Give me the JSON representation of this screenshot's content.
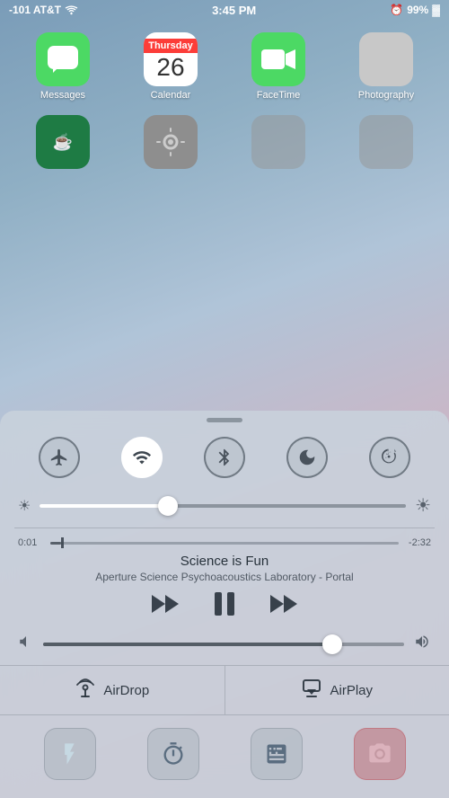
{
  "statusBar": {
    "carrier": "-101 AT&T",
    "time": "3:45 PM",
    "battery": "99%",
    "batteryIcon": "🔋",
    "alarmIcon": "⏰"
  },
  "appGrid": {
    "row1": [
      {
        "id": "messages",
        "label": "Messages"
      },
      {
        "id": "calendar",
        "label": "Calendar",
        "dayName": "Thursday",
        "dayNum": "26"
      },
      {
        "id": "facetime",
        "label": "FaceTime"
      },
      {
        "id": "photography",
        "label": "Photography"
      }
    ],
    "row2": [
      {
        "id": "starbucks",
        "label": ""
      },
      {
        "id": "settings",
        "label": ""
      },
      {
        "id": "gray1",
        "label": ""
      },
      {
        "id": "gray2",
        "label": ""
      }
    ]
  },
  "controlCenter": {
    "toggles": [
      {
        "id": "airplane",
        "label": "Airplane Mode",
        "symbol": "✈",
        "active": false
      },
      {
        "id": "wifi",
        "label": "Wi-Fi",
        "symbol": "wifi",
        "active": true
      },
      {
        "id": "bluetooth",
        "label": "Bluetooth",
        "symbol": "bt",
        "active": false
      },
      {
        "id": "donotdisturb",
        "label": "Do Not Disturb",
        "symbol": "🌙",
        "active": false
      },
      {
        "id": "rotation",
        "label": "Rotation Lock",
        "symbol": "rot",
        "active": false
      }
    ],
    "brightness": {
      "value": 35,
      "minLabel": "☀",
      "maxLabel": "☀"
    },
    "music": {
      "currentTime": "0:01",
      "totalTime": "-2:32",
      "progressPercent": 3,
      "title": "Science is Fun",
      "artist": "Aperture Science Psychoacoustics Laboratory - Portal",
      "controls": {
        "rewind": "⏮",
        "pause": "⏸",
        "forward": "⏭"
      }
    },
    "volume": {
      "value": 80,
      "minIcon": "🔇",
      "maxIcon": "🔊"
    },
    "services": [
      {
        "id": "airdrop",
        "label": "AirDrop",
        "icon": "airdrop"
      },
      {
        "id": "airplay",
        "label": "AirPlay",
        "icon": "airplay"
      }
    ],
    "tools": [
      {
        "id": "flashlight",
        "label": "Flashlight",
        "icon": "flashlight",
        "active": false
      },
      {
        "id": "timer",
        "label": "Timer",
        "icon": "timer",
        "active": false
      },
      {
        "id": "calculator",
        "label": "Calculator",
        "icon": "calculator",
        "active": false
      },
      {
        "id": "camera",
        "label": "Camera",
        "icon": "camera",
        "active": true
      }
    ]
  }
}
